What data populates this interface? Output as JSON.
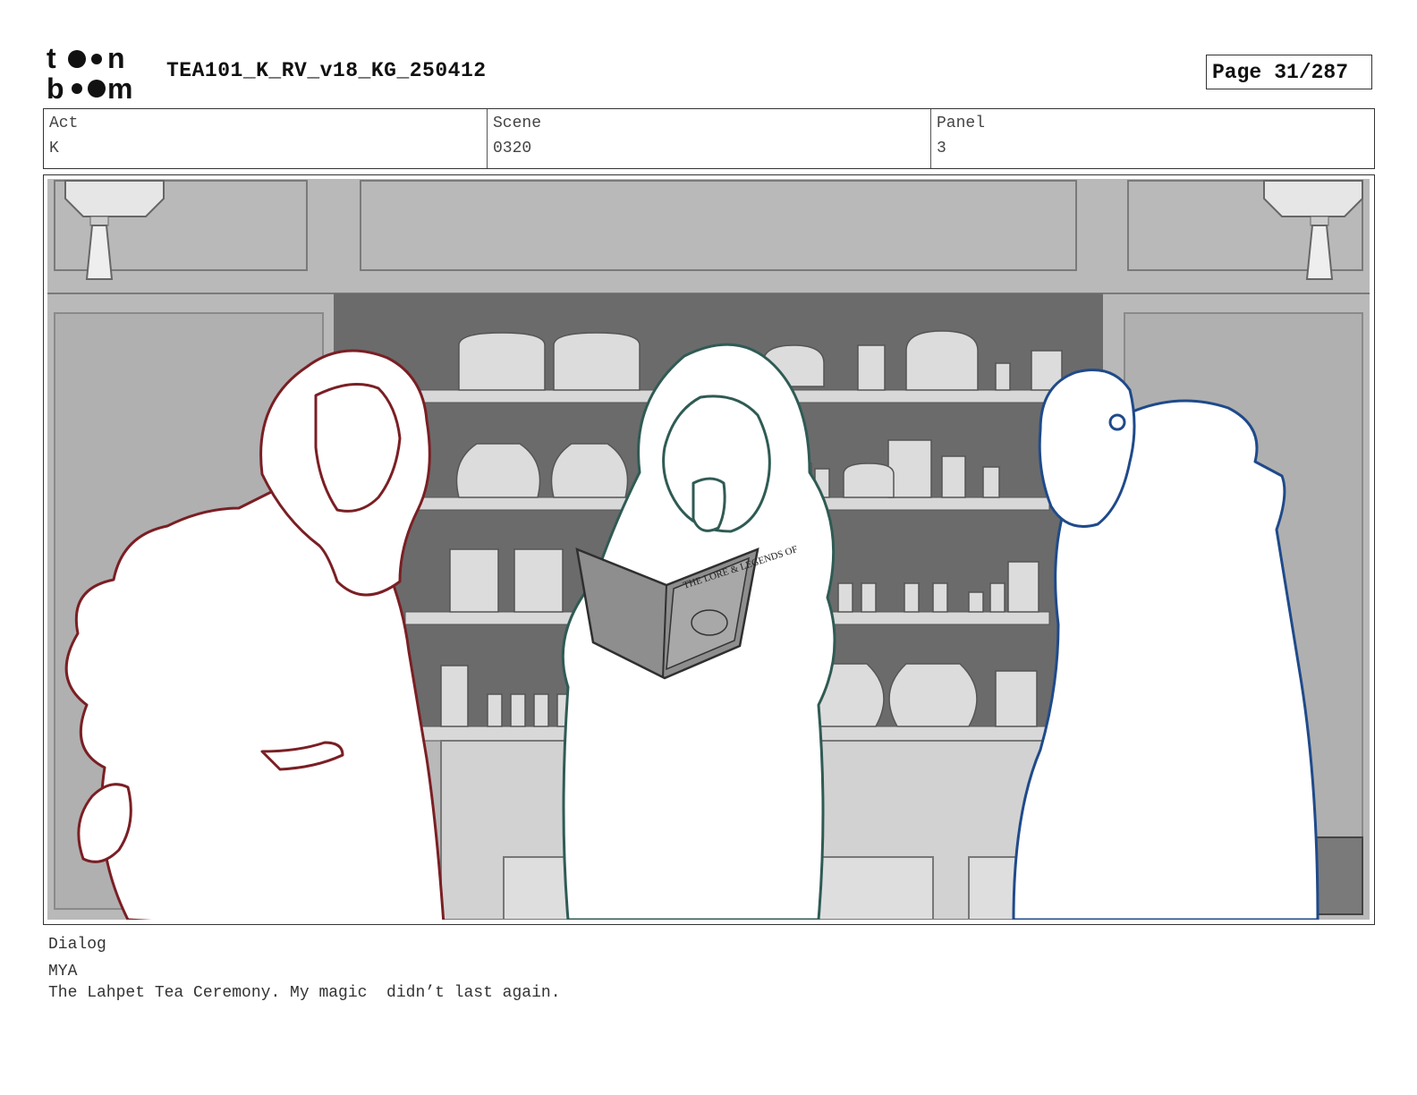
{
  "header": {
    "logo_text_top": "toon",
    "logo_text_bottom": "boom",
    "document_title": "TEA101_K_RV_v18_KG_250412",
    "page_label": "Page",
    "page_number": "31/287"
  },
  "info": {
    "act_label": "Act",
    "act_value": "K",
    "scene_label": "Scene",
    "scene_value": "0320",
    "panel_label": "Panel",
    "panel_value": "3"
  },
  "panel_art": {
    "book_title": "THE LORE & LEGENDS OF",
    "colors": {
      "background_gray": "#b9b9b9",
      "shelf_dark": "#6b6b6b",
      "left_character_line": "#7a1f24",
      "middle_character_line": "#2f5b54",
      "right_character_line": "#1f4a8a"
    }
  },
  "dialog": {
    "label": "Dialog",
    "speaker": "MYA",
    "line": "The Lahpet Tea Ceremony. My magic  didn’t last again."
  }
}
